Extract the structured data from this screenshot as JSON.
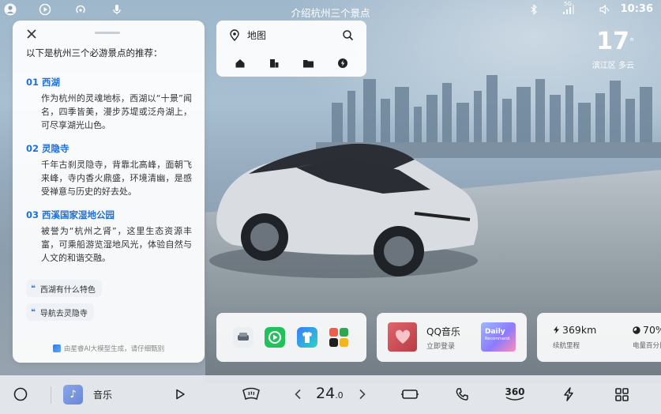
{
  "status_bar": {
    "title": "介绍杭州三个景点",
    "time": "10:36",
    "signal": "5G"
  },
  "weather": {
    "temperature": "17",
    "unit": "°",
    "district": "滨江区",
    "condition": "多云"
  },
  "ai_panel": {
    "intro": "以下是杭州三个必游景点的推荐：",
    "spots": [
      {
        "index": "01",
        "name": "西湖",
        "description": "作为杭州的灵魂地标，西湖以“十景”闻名，四季皆美，漫步苏堤或泛舟湖上，可尽享湖光山色。"
      },
      {
        "index": "02",
        "name": "灵隐寺",
        "description": "千年古刹灵隐寺，背靠北高峰，面朝飞来峰，寺内香火鼎盛，环境清幽，是感受禅意与历史的好去处。"
      },
      {
        "index": "03",
        "name": "西溪国家湿地公园",
        "description": "被誉为“杭州之肾”，这里生态资源丰富，可乘船游览湿地风光，体验自然与人文的和谐交融。"
      }
    ],
    "suggestions": [
      "西湖有什么特色",
      "导航去灵隐寺"
    ],
    "footer": "由星睿AI大模型生成，请仔细甄别"
  },
  "map_card": {
    "label": "地图"
  },
  "music_card": {
    "app_name": "QQ音乐",
    "action": "立即登录",
    "daily_title": "Daily",
    "daily_sub": "Recommend"
  },
  "stats": {
    "range_value": "369km",
    "range_label": "续航里程",
    "battery_value": "70%",
    "battery_label": "电量百分比"
  },
  "dock": {
    "music_label": "音乐",
    "temperature": "24",
    "temperature_decimal": ".0",
    "camera_label": "360"
  },
  "colors": {
    "accent_blue": "#1e6fd9",
    "panel_bg": "#ffffff",
    "dock_bg": "#e8ecf0"
  }
}
